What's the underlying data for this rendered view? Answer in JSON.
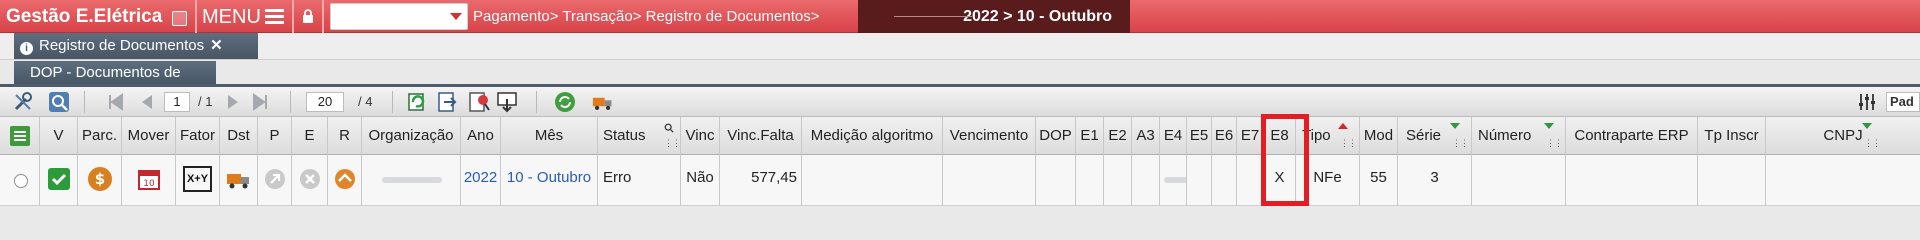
{
  "app": {
    "title": "Gestão E.Elétrica",
    "menu_label": "MENU"
  },
  "breadcrumb": "Pagamento>  Transação>  Registro de Documentos>",
  "period": "2022 > 10 - Outubro",
  "tabs": [
    {
      "label": "Registro de Documentos",
      "close": "✕"
    }
  ],
  "subtab": "DOP - Documentos de terceiros",
  "pagination": {
    "page": "1",
    "page_of": "/ 1",
    "page_size": "20",
    "size_of": "/ 4"
  },
  "right_field_value": "Pad",
  "table": {
    "headers": [
      "V",
      "Parc.",
      "Mover",
      "Fator",
      "Dst",
      "P",
      "E",
      "R",
      "Organização",
      "Ano",
      "Mês",
      "Status",
      "Vinc",
      "Vinc.Falta",
      "Medição algoritmo",
      "Vencimento",
      "DOP",
      "E1",
      "E2",
      "A3",
      "E4",
      "E5",
      "E6",
      "E7",
      "E8",
      "Tipo",
      "Mod",
      "Série",
      "Número",
      "Contraparte ERP",
      "Tp Inscr",
      "CNPJ"
    ],
    "row": {
      "fator_text": "X+Y",
      "ano": "2022",
      "mes": "10 - Outubro",
      "status": "Erro",
      "vinc": "Não",
      "vinc_falta": "577,45",
      "e8": "X",
      "tipo": "NFe",
      "mod": "55",
      "serie": "3"
    }
  },
  "colors": {
    "topbar": "#d84348",
    "period_bg": "#5a1b1d",
    "highlight": "#e21d24",
    "link": "#2a5db0"
  },
  "icons": [
    "tools-icon",
    "search-icon",
    "first-page-icon",
    "prev-page-icon",
    "next-page-icon",
    "last-page-icon",
    "refresh-icon",
    "export-icon",
    "report-icon",
    "download-icon",
    "sync-icon",
    "truck-icon",
    "settings-sliders-icon"
  ]
}
